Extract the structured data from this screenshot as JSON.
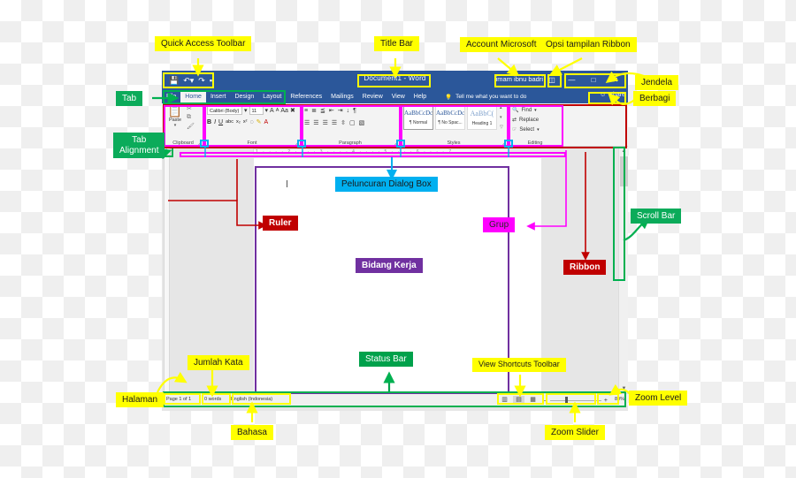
{
  "window": {
    "title": "Document1  -  Word",
    "account": "imam ibnu badri",
    "ribbon_display_options_icon": "ribbon-display-options-icon",
    "minimize": "—",
    "maximize": "□",
    "close": "✕",
    "quick_access": [
      {
        "name": "save-icon",
        "glyph": "💾"
      },
      {
        "name": "undo-icon",
        "glyph": "↶"
      },
      {
        "name": "redo-icon",
        "glyph": "↷"
      },
      {
        "name": "customize-qat-icon",
        "glyph": "▾"
      }
    ]
  },
  "tabs": [
    {
      "label": "File",
      "active": false
    },
    {
      "label": "Home",
      "active": true
    },
    {
      "label": "Insert",
      "active": false
    },
    {
      "label": "Design",
      "active": false
    },
    {
      "label": "Layout",
      "active": false
    },
    {
      "label": "References",
      "active": false
    },
    {
      "label": "Mailings",
      "active": false
    },
    {
      "label": "Review",
      "active": false
    },
    {
      "label": "View",
      "active": false
    },
    {
      "label": "Help",
      "active": false
    }
  ],
  "tell_me": {
    "icon": "lightbulb-icon",
    "text": "Tell me what you want to do"
  },
  "share": {
    "icon": "share-person-icon",
    "label": "Share"
  },
  "ribbon": {
    "clipboard": {
      "label": "Clipboard",
      "paste_label": "Paste",
      "paste_icon": "clipboard-icon",
      "cut_icon": "scissors-icon",
      "copy_icon": "copy-icon",
      "format_painter_icon": "format-painter-icon",
      "dialog_launcher": "dialog-box-launcher-icon"
    },
    "font": {
      "label": "Font",
      "font_name": "Calibri (Body)",
      "font_size": "11",
      "grow_font": "A",
      "shrink_font": "A",
      "change_case": "Aa",
      "clear_formatting_icon": "clear-formatting-icon",
      "bold": "B",
      "italic": "I",
      "underline": "U",
      "strikethrough": "abc",
      "subscript": "x₂",
      "superscript": "x²",
      "text_effects_icon": "text-effects-icon",
      "highlight_icon": "highlight-icon",
      "font_color_icon": "font-color-icon",
      "dialog_launcher": "dialog-box-launcher-icon"
    },
    "paragraph": {
      "label": "Paragraph",
      "bullets_icon": "bullets-icon",
      "numbering_icon": "numbering-icon",
      "multilevel_icon": "multilevel-list-icon",
      "decrease_indent_icon": "decrease-indent-icon",
      "increase_indent_icon": "increase-indent-icon",
      "sort_icon": "sort-icon",
      "show_marks_icon": "show-formatting-marks-icon",
      "align_left_icon": "align-left-icon",
      "align_center_icon": "align-center-icon",
      "align_right_icon": "align-right-icon",
      "justify_icon": "justify-icon",
      "line_spacing_icon": "line-spacing-icon",
      "shading_icon": "shading-icon",
      "borders_icon": "borders-icon",
      "dialog_launcher": "dialog-box-launcher-icon"
    },
    "styles": {
      "label": "Styles",
      "dialog_launcher": "dialog-box-launcher-icon",
      "items": [
        {
          "sample": "AaBbCcDc",
          "name": "¶ Normal",
          "selected": true
        },
        {
          "sample": "AaBbCcDc",
          "name": "¶ No Spac...",
          "selected": false
        },
        {
          "sample": "AaBbC(",
          "name": "Heading 1",
          "selected": false
        }
      ]
    },
    "editing": {
      "label": "Editing",
      "find": "Find",
      "replace": "Replace",
      "select": "Select",
      "find_icon": "search-icon",
      "replace_icon": "replace-icon",
      "select_icon": "select-icon"
    }
  },
  "ruler": {
    "corner_icon": "tab-alignment-icon",
    "horizontal_marks": "1 · · · · 2 · · · · 3 · · · · 4 · · · · 5 · · · · 6 · · · · 7"
  },
  "status_bar": {
    "page": "Page 1 of 1",
    "words": "0 words",
    "language": "English (Indonesia)",
    "view_icons": [
      {
        "name": "read-mode-icon",
        "glyph": "▥",
        "active": false
      },
      {
        "name": "print-layout-icon",
        "glyph": "▤",
        "active": true
      },
      {
        "name": "web-layout-icon",
        "glyph": "▦",
        "active": false
      }
    ],
    "zoom_out": "–",
    "zoom_in": "+",
    "zoom_level": "80%"
  },
  "scroll": {
    "up_arrow": "▲",
    "down_arrow": "▼"
  },
  "annotations": [
    {
      "id": "quick-access-toolbar",
      "text": "Quick Access Toolbar",
      "color": "yellow"
    },
    {
      "id": "title-bar",
      "text": "Title Bar",
      "color": "yellow"
    },
    {
      "id": "account-microsoft",
      "text": "Account Microsoft",
      "color": "yellow"
    },
    {
      "id": "opsi-tampilan-ribbon",
      "text": "Opsi tampilan Ribbon",
      "color": "yellow"
    },
    {
      "id": "jendela",
      "text": "Jendela",
      "color": "yellow"
    },
    {
      "id": "berbagi",
      "text": "Berbagi",
      "color": "yellow"
    },
    {
      "id": "tab",
      "text": "Tab",
      "color": "green"
    },
    {
      "id": "tab-alignment",
      "text": "Tab\nAlignment",
      "color": "green"
    },
    {
      "id": "peluncuran-dialog-box",
      "text": "Peluncuran Dialog Box",
      "color": "cyan"
    },
    {
      "id": "ruler",
      "text": "Ruler",
      "color": "darkred"
    },
    {
      "id": "grup",
      "text": "Grup",
      "color": "magenta"
    },
    {
      "id": "bidang-kerja",
      "text": "Bidang Kerja",
      "color": "purple"
    },
    {
      "id": "ribbon",
      "text": "Ribbon",
      "color": "darkred"
    },
    {
      "id": "scroll-bar",
      "text": "Scroll Bar",
      "color": "green"
    },
    {
      "id": "jumlah-kata",
      "text": "Jumlah Kata",
      "color": "yellow"
    },
    {
      "id": "status-bar",
      "text": "Status Bar",
      "color": "greenmid"
    },
    {
      "id": "view-shortcuts-toolbar",
      "text": "View Shortcuts Toolbar",
      "color": "yellow"
    },
    {
      "id": "halaman",
      "text": "Halaman",
      "color": "yellow"
    },
    {
      "id": "bahasa",
      "text": "Bahasa",
      "color": "yellow"
    },
    {
      "id": "zoom-slider",
      "text": "Zoom Slider",
      "color": "yellow"
    },
    {
      "id": "zoom-level",
      "text": "Zoom Level",
      "color": "yellow"
    }
  ],
  "labels": {
    "quick_access_toolbar": "Quick Access Toolbar",
    "title_bar": "Title Bar",
    "account_microsoft": "Account Microsoft",
    "opsi_tampilan_ribbon": "Opsi tampilan Ribbon",
    "jendela": "Jendela",
    "berbagi": "Berbagi",
    "tab": "Tab",
    "tab_alignment_l1": "Tab",
    "tab_alignment_l2": "Alignment",
    "peluncuran_dialog_box": "Peluncuran Dialog Box",
    "ruler": "Ruler",
    "grup": "Grup",
    "bidang_kerja": "Bidang Kerja",
    "ribbon": "Ribbon",
    "scroll_bar": "Scroll Bar",
    "jumlah_kata": "Jumlah Kata",
    "status_bar": "Status Bar",
    "view_shortcuts_toolbar": "View Shortcuts Toolbar",
    "halaman": "Halaman",
    "bahasa": "Bahasa",
    "zoom_slider": "Zoom Slider",
    "zoom_level": "Zoom Level"
  },
  "colors": {
    "word_blue": "#2b579a",
    "yellow": "#ffff00",
    "green": "#0bab5a",
    "dark_red": "#c00000",
    "magenta": "#ff00ff",
    "cyan": "#00b0f0",
    "purple": "#7030a0"
  }
}
